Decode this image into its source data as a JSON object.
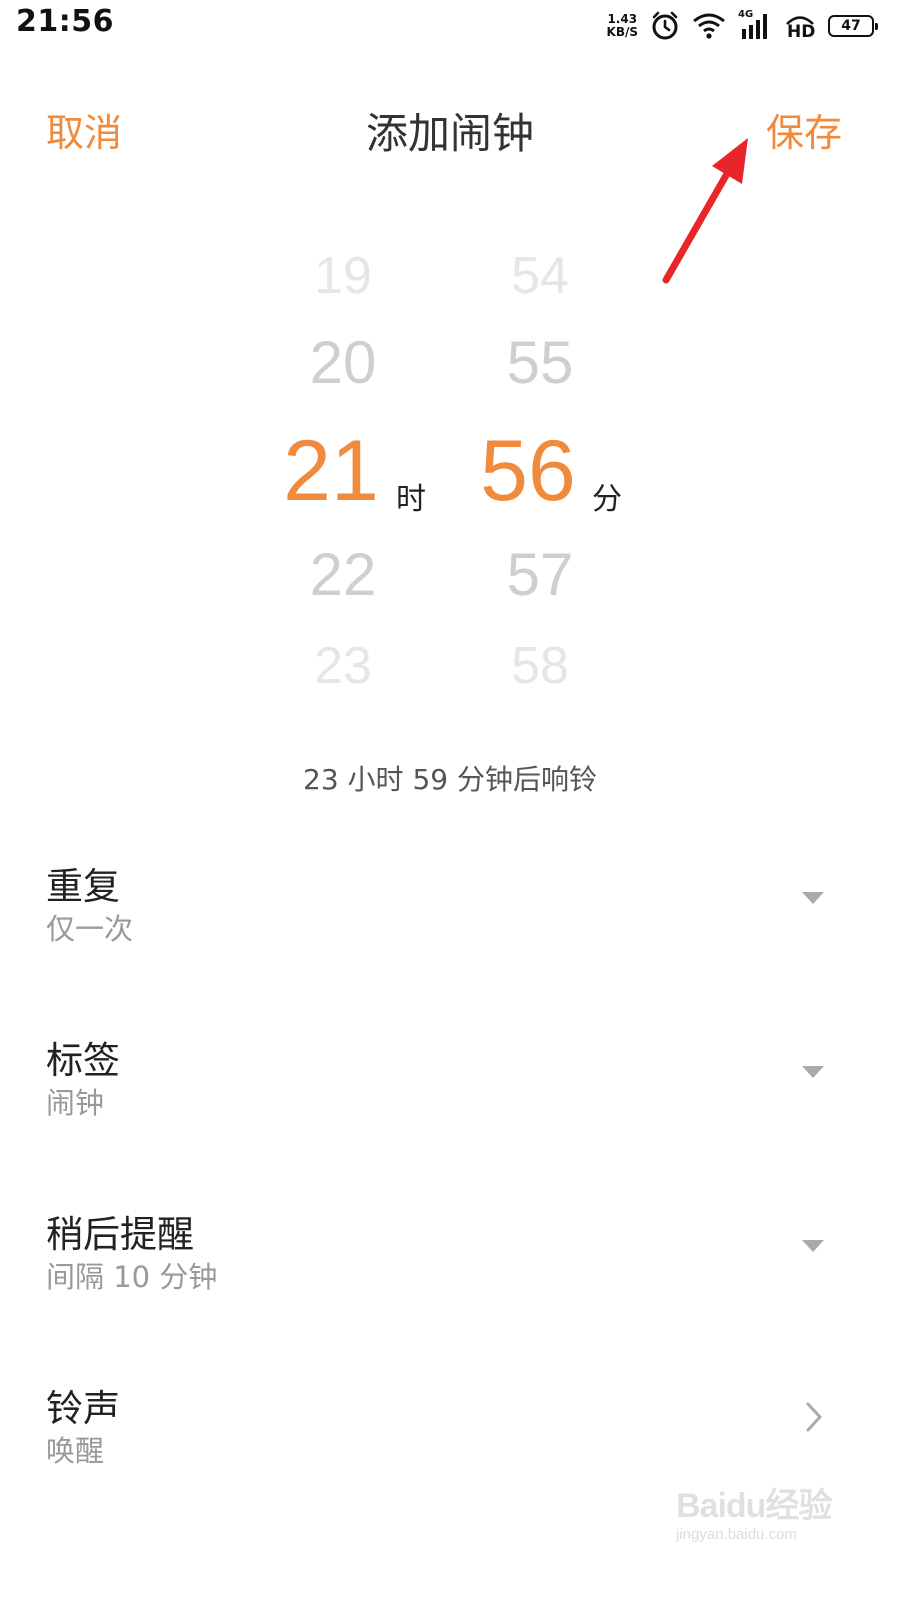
{
  "status_bar": {
    "time": "21:56",
    "net_speed_value": "1.43",
    "net_speed_unit": "KB/S",
    "network_type": "4G",
    "hd_label": "HD",
    "battery": "47",
    "icons": [
      "alarm-clock-icon",
      "wifi-icon",
      "cellular-signal-icon",
      "hd-icon",
      "battery-icon"
    ]
  },
  "header": {
    "cancel_label": "取消",
    "title": "添加闹钟",
    "save_label": "保存"
  },
  "time_picker": {
    "hours": [
      "19",
      "20",
      "21",
      "22",
      "23"
    ],
    "minutes": [
      "54",
      "55",
      "56",
      "57",
      "58"
    ],
    "selected_hour": "21",
    "selected_minute": "56",
    "hour_unit": "时",
    "minute_unit": "分"
  },
  "countdown_text": "23 小时 59 分钟后响铃",
  "settings": [
    {
      "label": "重复",
      "value": "仅一次",
      "control": "dropdown"
    },
    {
      "label": "标签",
      "value": "闹钟",
      "control": "dropdown"
    },
    {
      "label": "稍后提醒",
      "value": "间隔 10 分钟",
      "control": "dropdown"
    },
    {
      "label": "铃声",
      "value": "唤醒",
      "control": "chevron"
    }
  ],
  "watermark": {
    "text": "Baidu经验",
    "url": "jingyan.baidu.com"
  },
  "colors": {
    "accent": "#f08a3c",
    "annotation_arrow": "#e8262a"
  }
}
